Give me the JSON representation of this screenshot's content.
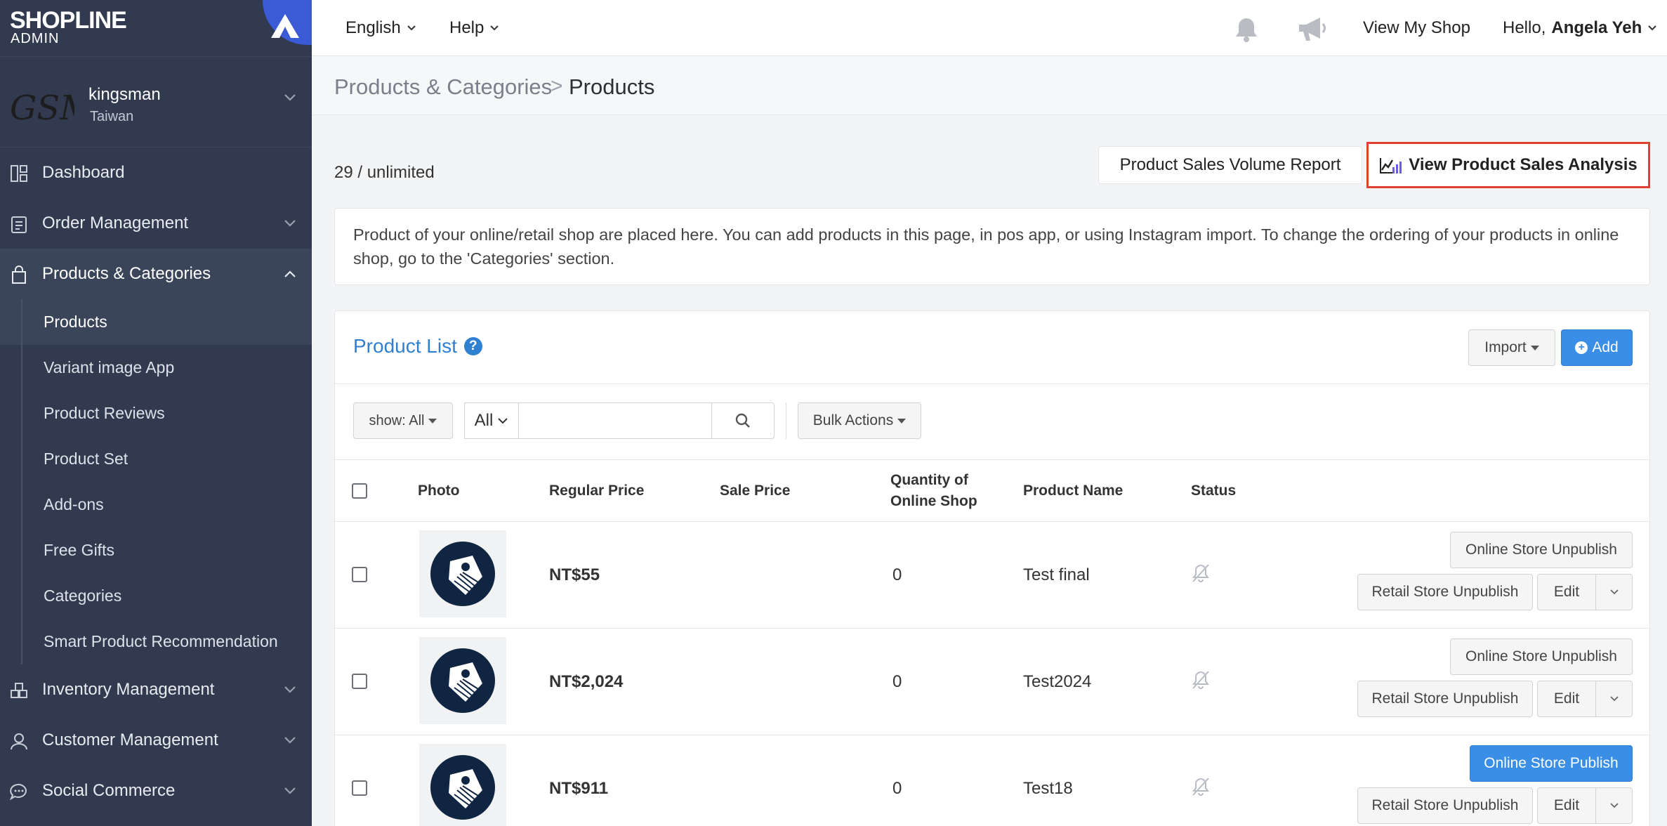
{
  "brand": {
    "name": "SHOPLINE",
    "sub": "ADMIN"
  },
  "shop": {
    "logo_text": "GSM",
    "name": "kingsman",
    "region": "Taiwan"
  },
  "sidebar": {
    "items": [
      {
        "label": "Dashboard"
      },
      {
        "label": "Order Management"
      },
      {
        "label": "Products & Categories"
      },
      {
        "label": "Inventory Management"
      },
      {
        "label": "Customer Management"
      },
      {
        "label": "Social Commerce"
      }
    ],
    "sub_items": [
      {
        "label": "Products"
      },
      {
        "label": "Variant image App"
      },
      {
        "label": "Product Reviews"
      },
      {
        "label": "Product Set"
      },
      {
        "label": "Add-ons"
      },
      {
        "label": "Free Gifts"
      },
      {
        "label": "Categories"
      },
      {
        "label": "Smart Product Recommendation"
      }
    ]
  },
  "topbar": {
    "language": "English",
    "help": "Help",
    "view_shop": "View My Shop",
    "greeting": "Hello,",
    "user": "Angela Yeh"
  },
  "breadcrumb": {
    "parent": "Products & Categories",
    "separator": ">",
    "current": "Products"
  },
  "content": {
    "count": "29 / unlimited",
    "report_button": "Product Sales Volume Report",
    "analysis_button": "View Product Sales Analysis",
    "info": "Product of your online/retail shop are placed here. You can add products in this page, in pos app, or using Instagram import. To change the ordering of your products in online shop, go to the 'Categories' section."
  },
  "list": {
    "title": "Product List",
    "help": "?",
    "import_label": "Import",
    "add_label": "Add",
    "show_filter": "show: All",
    "scope": "All",
    "search_placeholder": "",
    "bulk_label": "Bulk Actions",
    "headers": {
      "photo": "Photo",
      "regular_price": "Regular Price",
      "sale_price": "Sale Price",
      "quantity_line1": "Quantity of",
      "quantity_line2": "Online Shop",
      "product_name": "Product Name",
      "status": "Status"
    },
    "rows": [
      {
        "price": "NT$55",
        "sale": "",
        "qty": "0",
        "name": "Test final",
        "online_btn": "Online Store Unpublish",
        "online_primary": false,
        "retail_btn": "Retail Store Unpublish",
        "edit": "Edit"
      },
      {
        "price": "NT$2,024",
        "sale": "",
        "qty": "0",
        "name": "Test2024",
        "online_btn": "Online Store Unpublish",
        "online_primary": false,
        "retail_btn": "Retail Store Unpublish",
        "edit": "Edit"
      },
      {
        "price": "NT$911",
        "sale": "",
        "qty": "0",
        "name": "Test18",
        "online_btn": "Online Store Publish",
        "online_primary": true,
        "retail_btn": "Retail Store Unpublish",
        "edit": "Edit"
      }
    ]
  },
  "colors": {
    "sidebar": "#313a4e",
    "accent": "#3a8ee6",
    "link": "#2f80d1",
    "highlight": "#e0402d"
  }
}
